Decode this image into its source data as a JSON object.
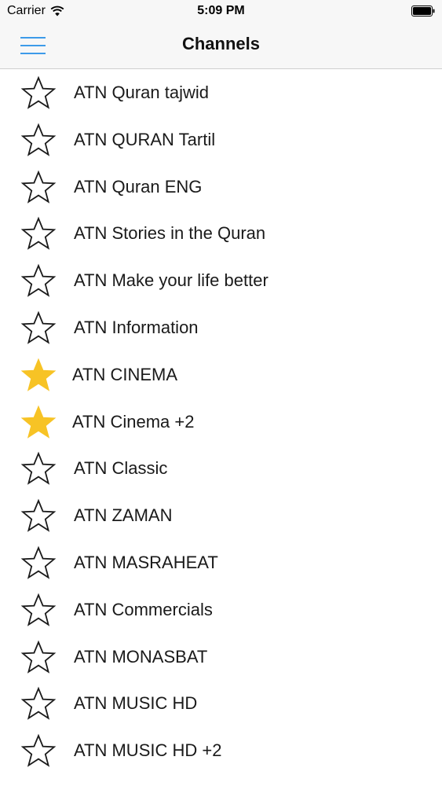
{
  "status_bar": {
    "carrier": "Carrier",
    "time": "5:09 PM",
    "wifi_icon": "wifi-icon",
    "battery_icon": "battery-full-icon"
  },
  "nav_bar": {
    "title": "Channels",
    "menu_icon": "hamburger-menu-icon",
    "accent_color": "#3d9be9"
  },
  "colors": {
    "star_favorite": "#f7c325",
    "star_outline": "#1a1a1a"
  },
  "channels": [
    {
      "name": "ATN Quran tajwid",
      "favorite": false
    },
    {
      "name": "ATN QURAN Tartil",
      "favorite": false
    },
    {
      "name": "ATN Quran ENG",
      "favorite": false
    },
    {
      "name": "ATN Stories in the Quran",
      "favorite": false
    },
    {
      "name": "ATN Make your life better",
      "favorite": false
    },
    {
      "name": "ATN Information",
      "favorite": false
    },
    {
      "name": "ATN CINEMA",
      "favorite": true
    },
    {
      "name": "ATN Cinema +2",
      "favorite": true
    },
    {
      "name": "ATN Classic",
      "favorite": false
    },
    {
      "name": "ATN ZAMAN",
      "favorite": false
    },
    {
      "name": "ATN MASRAHEAT",
      "favorite": false
    },
    {
      "name": "ATN Commercials",
      "favorite": false
    },
    {
      "name": "ATN MONASBAT",
      "favorite": false
    },
    {
      "name": "ATN MUSIC HD",
      "favorite": false
    },
    {
      "name": "ATN MUSIC HD +2",
      "favorite": false
    }
  ]
}
